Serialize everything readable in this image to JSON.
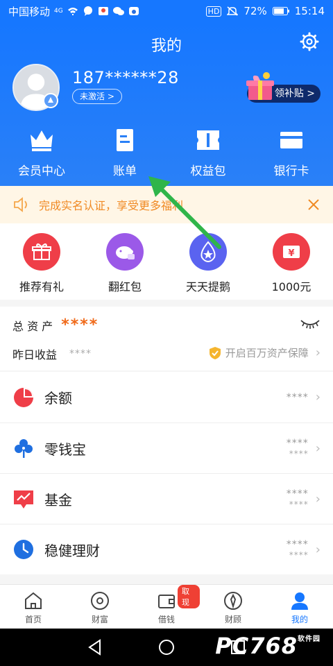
{
  "statusbar": {
    "carrier": "中国移动",
    "network": "4G",
    "battery": "72%",
    "time": "15:14",
    "hd": "HD"
  },
  "header": {
    "title": "我的",
    "phone": "187******28",
    "inactive_label": "未激活 >",
    "bonus_label": "领补贴 >"
  },
  "quick_actions": [
    {
      "label": "会员中心",
      "icon": "crown-icon"
    },
    {
      "label": "账单",
      "icon": "bill-icon"
    },
    {
      "label": "权益包",
      "icon": "ticket-icon"
    },
    {
      "label": "银行卡",
      "icon": "card-icon"
    }
  ],
  "notice": {
    "text": "完成实名认证，享受更多福利"
  },
  "promos": [
    {
      "label": "推荐有礼",
      "icon": "gift-icon",
      "color": "#ef3e48"
    },
    {
      "label": "翻红包",
      "icon": "piggy-icon",
      "color": "#9b59e8"
    },
    {
      "label": "天天提鹅",
      "icon": "star-drop-icon",
      "color": "#5a63f0"
    },
    {
      "label": "1000元",
      "icon": "yen-ticket-icon",
      "color": "#ef3e48"
    }
  ],
  "assets": {
    "total_label": "总 资 产",
    "total_value": "****",
    "yesterday_label": "昨日收益",
    "yesterday_value": "****",
    "guard_label": "开启百万资产保障"
  },
  "accounts": [
    {
      "name": "余额",
      "value1": "****",
      "value2": "",
      "icon": "pie-icon",
      "color": "#ef3e48"
    },
    {
      "name": "零钱宝",
      "value1": "****",
      "value2": "****",
      "icon": "clover-icon",
      "color": "#1f6fe0"
    },
    {
      "name": "基金",
      "value1": "****",
      "value2": "****",
      "icon": "trend-icon",
      "color": "#ef3e48"
    },
    {
      "name": "稳健理财",
      "value1": "****",
      "value2": "****",
      "icon": "clock-icon",
      "color": "#1f6fe0"
    }
  ],
  "tabs": [
    {
      "label": "首页",
      "icon": "home-icon"
    },
    {
      "label": "财富",
      "icon": "wealth-icon"
    },
    {
      "label": "借钱",
      "icon": "wallet-icon",
      "badge": "取现"
    },
    {
      "label": "财顾",
      "icon": "advisor-icon"
    },
    {
      "label": "我的",
      "icon": "person-icon"
    }
  ],
  "watermark": {
    "text": "PC768",
    "sub": "软件园"
  }
}
